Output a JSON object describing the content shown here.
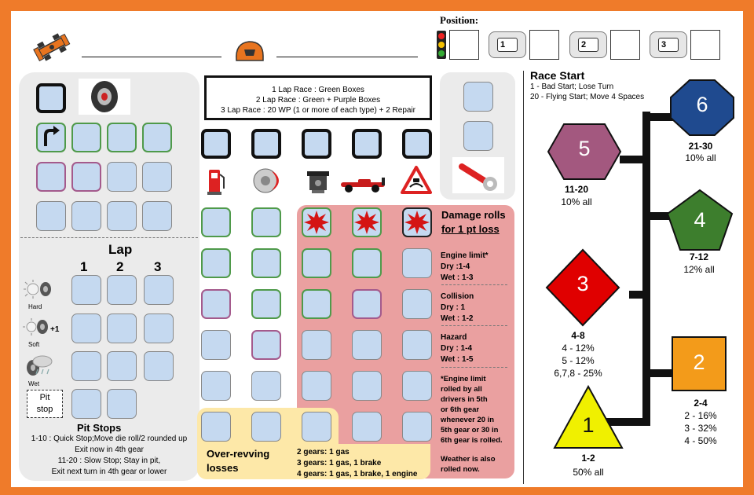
{
  "header": {
    "position_label": "Position:",
    "lap_icons": [
      "1",
      "2",
      "3"
    ]
  },
  "race_rules": {
    "line1": "1 Lap Race : Green Boxes",
    "line2": "2 Lap Race : Green + Purple Boxes",
    "line3": "3 Lap Race : 20 WP (1 or more of each type) + 2 Repair"
  },
  "lap_tracker": {
    "title": "Lap",
    "columns": [
      "1",
      "2",
      "3"
    ],
    "tires": [
      {
        "label": "Hard",
        "icon": "hard-tire-icon"
      },
      {
        "label": "Soft",
        "icon": "soft-tire-icon",
        "badge": "+1"
      },
      {
        "label": "Wet",
        "icon": "wet-tire-icon"
      }
    ],
    "pit_stop_label_1": "Pit",
    "pit_stop_label_2": "stop"
  },
  "pit_stops": {
    "title": "Pit Stops",
    "line1": "1-10 : Quick Stop;Move die roll/2 rounded up",
    "line2": "Exit now in 4th gear",
    "line3": "11-20 : Slow Stop; Stay in pit,",
    "line4": "Exit next turn in 4th gear or lower"
  },
  "damage": {
    "title_1": "Damage rolls",
    "title_2": "for 1 pt  loss",
    "engine_title": "Engine limit*",
    "engine_dry": "Dry :1-4",
    "engine_wet": "Wet : 1-3",
    "collision_title": "Collision",
    "collision_dry": "Dry : 1",
    "collision_wet": "Wet : 1-2",
    "hazard_title": "Hazard",
    "hazard_dry": "Dry : 1-4",
    "hazard_wet": "Wet : 1-5",
    "note_lines": [
      "*Engine limit",
      "rolled by all",
      "drivers in 5th",
      "or 6th gear",
      "whenever 20 in",
      "5th gear  or 30 in",
      "6th gear is rolled."
    ],
    "weather_lines": [
      "Weather is also",
      "rolled now."
    ]
  },
  "overrev": {
    "title_1": "Over-revving",
    "title_2": "losses",
    "line1": "2 gears: 1 gas",
    "line2": "3 gears: 1 gas, 1 brake",
    "line3": "4 gears: 1 gas, 1 brake, 1 engine"
  },
  "race_start": {
    "title": "Race Start",
    "line1": "1 - Bad Start; Lose Turn",
    "line2": "20 - Flying Start; Move 4 Spaces",
    "gears": [
      {
        "number": "6",
        "range": "21-30",
        "odds": [
          "10% all"
        ],
        "color": "#1f4a8f"
      },
      {
        "number": "5",
        "range": "11-20",
        "odds": [
          "10% all"
        ],
        "color": "#a3587f"
      },
      {
        "number": "4",
        "range": "7-12",
        "odds": [
          "12% all"
        ],
        "color": "#3d7e2d"
      },
      {
        "number": "3",
        "range": "4-8",
        "odds": [
          "4 - 12%",
          "5 - 12%",
          "6,7,8  - 25%"
        ],
        "color": "#e00000"
      },
      {
        "number": "2",
        "range": "2-4",
        "odds": [
          "2 - 16%",
          "3 - 32%",
          "4 - 50%"
        ],
        "color": "#f39b1a"
      },
      {
        "number": "1",
        "range": "1-2",
        "odds": [
          "50% all"
        ],
        "color": "#f0f000"
      }
    ]
  },
  "colors": {
    "border": "#ef7b2a",
    "box_fill": "#c5d9f0",
    "green_box": "#4f9a4a",
    "purple_box": "#a45a8c",
    "damage_panel": "#eaa0a0",
    "overrev_panel": "#fde8a8"
  }
}
